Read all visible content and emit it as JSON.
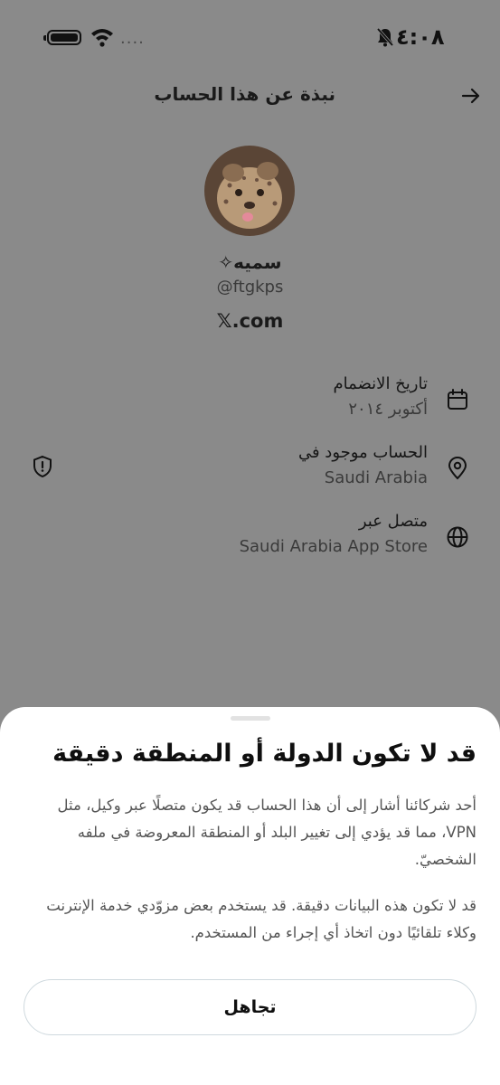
{
  "status_bar": {
    "time": "٤:٠٨",
    "signal_dots": "....",
    "icons": [
      "battery-icon",
      "wifi-icon",
      "bell-muted-icon"
    ]
  },
  "header": {
    "title": "نبذة عن هذا الحساب",
    "back_icon": "arrow-right-icon"
  },
  "profile": {
    "display_name": "سميه✧",
    "handle": "@ftgkps",
    "domain": "𝕏.com"
  },
  "info": {
    "joined": {
      "label": "تاريخ الانضمام",
      "value": "أكتوبر ٢٠١٤",
      "icon": "calendar-icon"
    },
    "location": {
      "label": "الحساب موجود في",
      "value": "Saudi Arabia",
      "icon": "location-pin-icon",
      "badge_icon": "shield-icon"
    },
    "connected": {
      "label": "متصل عبر",
      "value": "Saudi Arabia App Store",
      "icon": "globe-icon"
    }
  },
  "sheet": {
    "title": "قد لا تكون الدولة أو المنطقة دقيقة",
    "paragraph1": "أحد شركائنا أشار إلى أن هذا الحساب قد يكون متصلًا عبر وكيل، مثل VPN، مما قد يؤدي إلى تغيير البلد أو المنطقة المعروضة في ملفه الشخصيّ.",
    "paragraph2": "قد لا تكون هذه البيانات دقيقة. قد يستخدم بعض مزوّدي خدمة الإنترنت وكلاء تلقائيًا دون اتخاذ أي إجراء من المستخدم.",
    "dismiss_label": "تجاهل"
  },
  "colors": {
    "overlay": "#8a8a8a",
    "sheet_bg": "#ffffff",
    "text_primary": "#0f0f0f",
    "text_secondary": "#555555",
    "button_border": "#cfd9de"
  }
}
